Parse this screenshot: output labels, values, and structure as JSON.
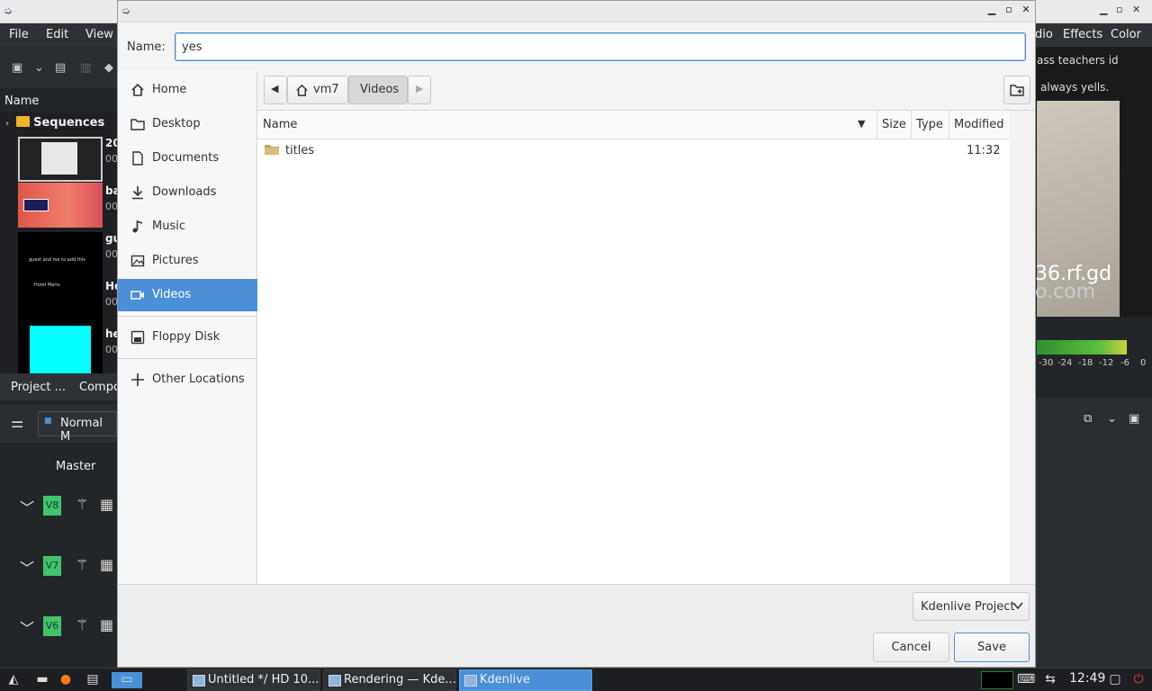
{
  "background_app": {
    "menu_left": [
      "File",
      "Edit",
      "View"
    ],
    "menu_right": [
      "dio",
      "Effects",
      "Color"
    ],
    "bin_header": "Name",
    "sequences_label": "Sequences",
    "bin_items": [
      {
        "label": "20",
        "sub": "00"
      },
      {
        "label": "ba",
        "sub": "00"
      },
      {
        "label": "gu",
        "sub": "00"
      },
      {
        "label": "Ho",
        "sub": "00"
      },
      {
        "label": "he",
        "sub": "00"
      }
    ],
    "thumb_text_1": "guest and me to add this",
    "thumb_text_2": "Hotel Mario",
    "tabs": [
      "Project ...",
      "Compo"
    ],
    "mixer_mode": "Normal M",
    "master_label": "Master",
    "tracks": [
      "V8",
      "V7",
      "V6"
    ],
    "preview_text_1": "ass teachers id",
    "preview_text_2": "always yells.",
    "preview_big_1": "36.rf.gd",
    "preview_big_2": "o.com",
    "meter_scale": [
      "-30",
      "-24",
      "-18",
      "-12",
      "-6",
      "0"
    ]
  },
  "dialog": {
    "name_label": "Name:",
    "name_value": "yes",
    "places": [
      {
        "label": "Home",
        "icon": "home-icon"
      },
      {
        "label": "Desktop",
        "icon": "folder-icon"
      },
      {
        "label": "Documents",
        "icon": "document-icon"
      },
      {
        "label": "Downloads",
        "icon": "download-icon"
      },
      {
        "label": "Music",
        "icon": "music-icon"
      },
      {
        "label": "Pictures",
        "icon": "picture-icon"
      },
      {
        "label": "Videos",
        "icon": "video-icon",
        "selected": true
      },
      {
        "label": "Floppy Disk",
        "icon": "floppy-icon"
      },
      {
        "label": "Other Locations",
        "icon": "plus-icon"
      }
    ],
    "path": {
      "home_segment": "vm7",
      "current_segment": "Videos"
    },
    "columns": [
      "Name",
      "Size",
      "Type",
      "Modified"
    ],
    "files": [
      {
        "name": "titles",
        "size": "",
        "type": "",
        "modified": "11:32",
        "kind": "folder"
      }
    ],
    "filter": "Kdenlive Project",
    "cancel_label": "Cancel",
    "save_label": "Save"
  },
  "taskbar": {
    "tasks": [
      {
        "label": "Untitled */ HD 10...",
        "active": false
      },
      {
        "label": "Rendering — Kde...",
        "active": false
      },
      {
        "label": "Kdenlive",
        "active": true
      }
    ],
    "clock": "12:49"
  },
  "colors": {
    "selection": "#4a90d9",
    "dialog_bg": "#efefef",
    "track_green": "#3fc46a"
  }
}
